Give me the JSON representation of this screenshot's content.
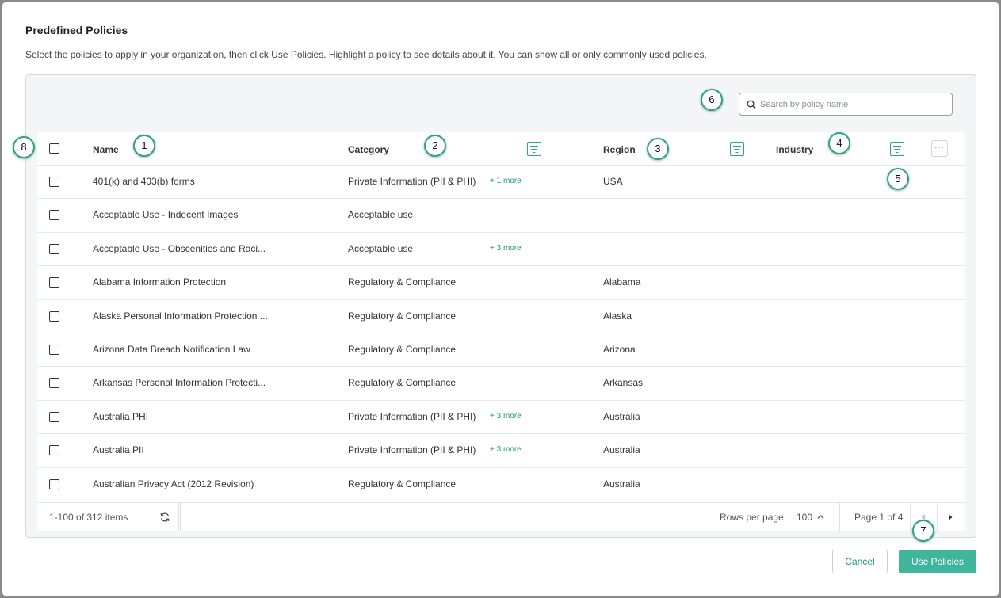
{
  "dialog": {
    "title": "Predefined Policies",
    "description": "Select the policies to apply in your organization, then click Use Policies. Highlight a policy to see details about it. You can show all or only commonly used policies."
  },
  "search": {
    "placeholder": "Search by policy name",
    "value": ""
  },
  "table": {
    "columns": {
      "name": "Name",
      "category": "Category",
      "region": "Region",
      "industry": "Industry"
    },
    "rows": [
      {
        "name": "401(k) and 403(b) forms",
        "category": "Private Information (PII & PHI)",
        "more": "+ 1 more",
        "region": "USA",
        "industry": ""
      },
      {
        "name": "Acceptable Use - Indecent Images",
        "category": "Acceptable use",
        "more": "",
        "region": "",
        "industry": ""
      },
      {
        "name": "Acceptable Use - Obscenities and Raci...",
        "category": "Acceptable use",
        "more": "+ 3 more",
        "region": "",
        "industry": ""
      },
      {
        "name": "Alabama Information Protection",
        "category": "Regulatory & Compliance",
        "more": "",
        "region": "Alabama",
        "industry": ""
      },
      {
        "name": "Alaska Personal Information Protection ...",
        "category": "Regulatory & Compliance",
        "more": "",
        "region": "Alaska",
        "industry": ""
      },
      {
        "name": "Arizona Data Breach Notification Law",
        "category": "Regulatory & Compliance",
        "more": "",
        "region": "Arizona",
        "industry": ""
      },
      {
        "name": "Arkansas Personal Information Protecti...",
        "category": "Regulatory & Compliance",
        "more": "",
        "region": "Arkansas",
        "industry": ""
      },
      {
        "name": "Australia PHI",
        "category": "Private Information (PII & PHI)",
        "more": "+ 3 more",
        "region": "Australia",
        "industry": ""
      },
      {
        "name": "Australia PII",
        "category": "Private Information (PII & PHI)",
        "more": "+ 3 more",
        "region": "Australia",
        "industry": ""
      },
      {
        "name": "Australian Privacy Act (2012 Revision)",
        "category": "Regulatory & Compliance",
        "more": "",
        "region": "Australia",
        "industry": ""
      }
    ]
  },
  "footer": {
    "items_count": "1-100 of 312 items",
    "rows_per_page_label": "Rows per page:",
    "rows_per_page_value": "100",
    "page_label": "Page 1 of 4"
  },
  "buttons": {
    "cancel": "Cancel",
    "use": "Use Policies"
  },
  "callouts": [
    "1",
    "2",
    "3",
    "4",
    "5",
    "6",
    "7",
    "8"
  ],
  "colors": {
    "accent": "#3fb59b",
    "link": "#1a9a7e"
  }
}
